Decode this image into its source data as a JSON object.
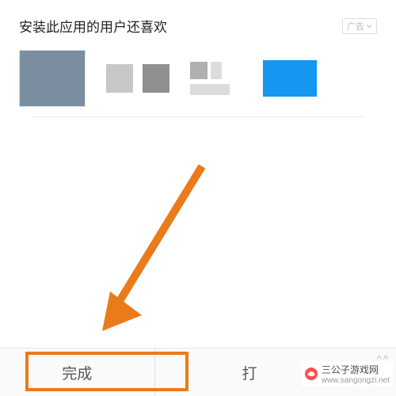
{
  "section": {
    "title": "安装此应用的用户还喜欢",
    "ad_label": "广告"
  },
  "footer": {
    "done_label": "完成",
    "open_label": "打"
  },
  "colors": {
    "accent": "#e97b1a",
    "thumb_blue_gray": "#7b8da1",
    "thumb_gray1": "#c7c7c7",
    "thumb_gray2": "#8f8f8f",
    "thumb_gray3": "#b0b0b0",
    "thumb_gray4": "#dcdcdc",
    "thumb_blue": "#1596f0"
  },
  "footprint": {
    "brand": "三公子游戏网",
    "url": "www.sangongzi.net"
  }
}
